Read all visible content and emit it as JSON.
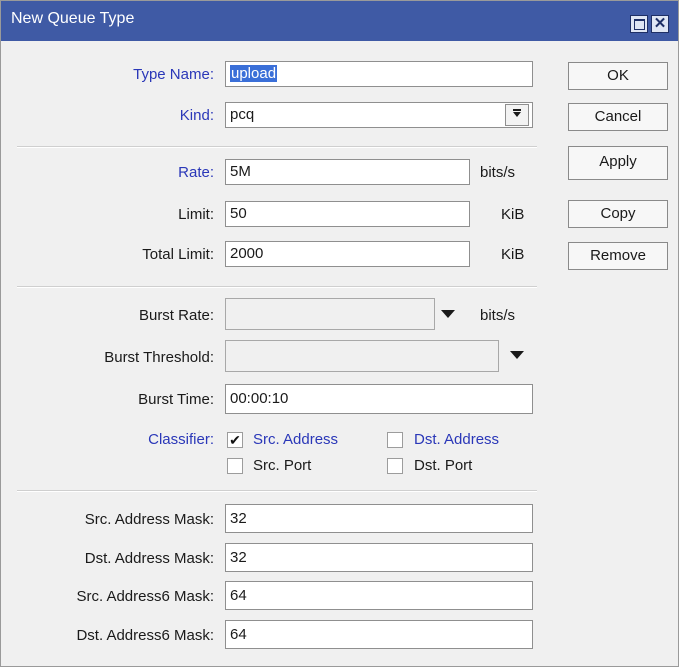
{
  "window": {
    "title": "New Queue Type"
  },
  "form": {
    "type_name": {
      "label": "Type Name:",
      "value": "upload"
    },
    "kind": {
      "label": "Kind:",
      "value": "pcq"
    },
    "rate": {
      "label": "Rate:",
      "value": "5M",
      "unit": "bits/s"
    },
    "limit": {
      "label": "Limit:",
      "value": "50",
      "unit": "KiB"
    },
    "total_limit": {
      "label": "Total Limit:",
      "value": "2000",
      "unit": "KiB"
    },
    "burst_rate": {
      "label": "Burst Rate:",
      "value": "",
      "unit": "bits/s"
    },
    "burst_threshold": {
      "label": "Burst Threshold:",
      "value": ""
    },
    "burst_time": {
      "label": "Burst Time:",
      "value": "00:00:10"
    },
    "classifier": {
      "label": "Classifier:",
      "options": [
        {
          "label": "Src. Address",
          "checked": true
        },
        {
          "label": "Dst. Address",
          "checked": false
        },
        {
          "label": "Src. Port",
          "checked": false
        },
        {
          "label": "Dst. Port",
          "checked": false
        }
      ]
    },
    "src_address_mask": {
      "label": "Src. Address Mask:",
      "value": "32"
    },
    "dst_address_mask": {
      "label": "Dst. Address Mask:",
      "value": "32"
    },
    "src_address6_mask": {
      "label": "Src. Address6 Mask:",
      "value": "64"
    },
    "dst_address6_mask": {
      "label": "Dst. Address6 Mask:",
      "value": "64"
    }
  },
  "buttons": {
    "ok": "OK",
    "cancel": "Cancel",
    "apply": "Apply",
    "copy": "Copy",
    "remove": "Remove"
  },
  "icons": {
    "checkmark": "✔",
    "dropdown": "▼"
  },
  "colors": {
    "titlebar": "#3f5aa5",
    "blue_label": "#2a37b8",
    "selection": "#3a6fd8"
  }
}
